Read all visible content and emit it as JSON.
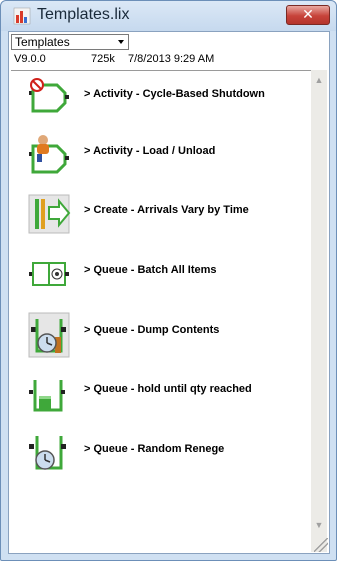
{
  "window": {
    "title": "Templates.lix",
    "close_glyph": "✕",
    "app_icon": "chart-app-icon"
  },
  "toolbar": {
    "dropdown_value": "Templates"
  },
  "info": {
    "version": "V9.0.0",
    "size": "725k",
    "date": "7/8/2013 9:29 AM"
  },
  "templates": [
    {
      "label": "> Activity - Cycle-Based Shutdown",
      "icon": "activity-shutdown-icon"
    },
    {
      "label": "> Activity - Load / Unload",
      "icon": "activity-load-unload-icon"
    },
    {
      "label": "> Create - Arrivals Vary by Time",
      "icon": "create-arrivals-icon"
    },
    {
      "label": "> Queue - Batch All Items",
      "icon": "queue-batch-icon"
    },
    {
      "label": "> Queue - Dump Contents",
      "icon": "queue-dump-icon"
    },
    {
      "label": "> Queue - hold until qty reached",
      "icon": "queue-hold-icon"
    },
    {
      "label": "> Queue - Random Renege",
      "icon": "queue-renege-icon"
    }
  ],
  "scroll": {
    "up_glyph": "▲",
    "down_glyph": "▼"
  }
}
